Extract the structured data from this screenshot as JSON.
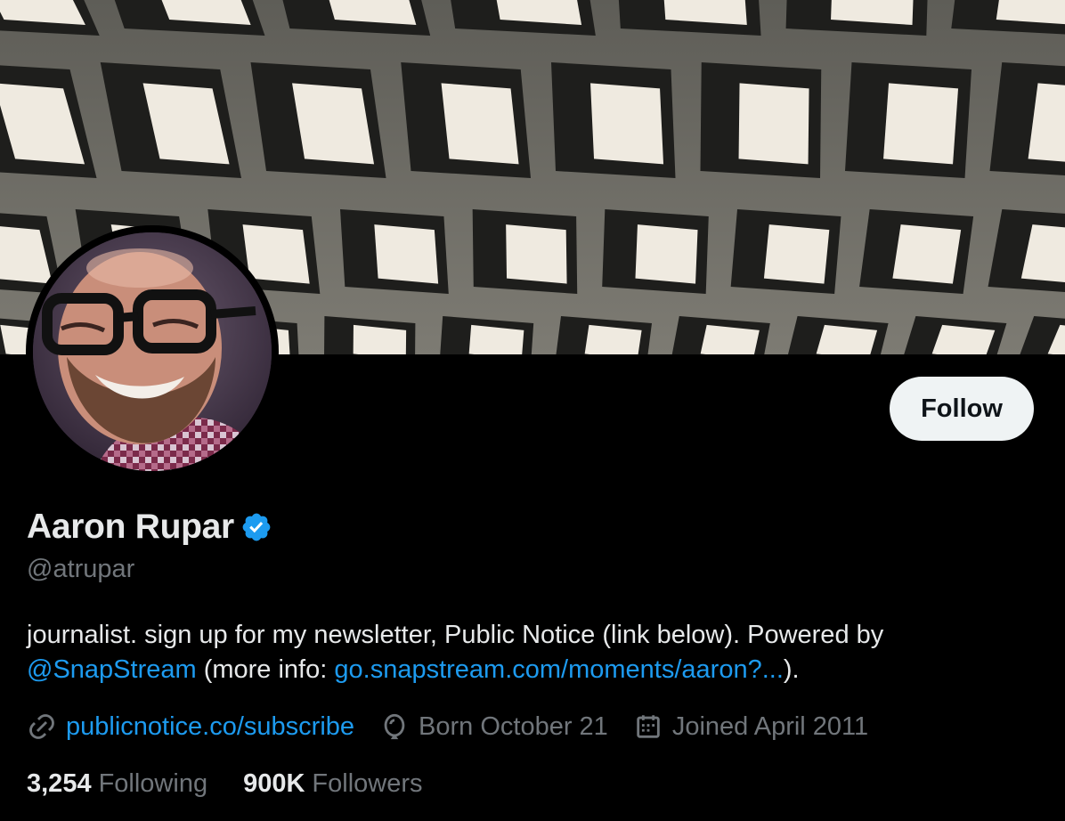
{
  "profile": {
    "display_name": "Aaron Rupar",
    "handle": "@atrupar",
    "verified": true,
    "follow_label": "Follow"
  },
  "bio": {
    "text_1": "journalist. sign up for my newsletter, Public Notice (link below). Powered by",
    "mention": "@SnapStream",
    "text_2": "(more info:",
    "link": "go.snapstream.com/moments/aaron?...",
    "text_3": ")."
  },
  "meta": {
    "website": "publicnotice.co/subscribe",
    "born": "Born October 21",
    "joined": "Joined April 2011"
  },
  "stats": {
    "following_count": "3,254",
    "following_label": "Following",
    "followers_count": "900K",
    "followers_label": "Followers"
  },
  "icons": {
    "link": "link-icon",
    "born": "balloon-icon",
    "joined": "calendar-icon",
    "verified": "verified-badge-icon"
  },
  "colors": {
    "background": "#000000",
    "text_primary": "#e7e9ea",
    "text_secondary": "#71767b",
    "accent": "#1d9bf0",
    "button_bg": "#eff3f4"
  }
}
